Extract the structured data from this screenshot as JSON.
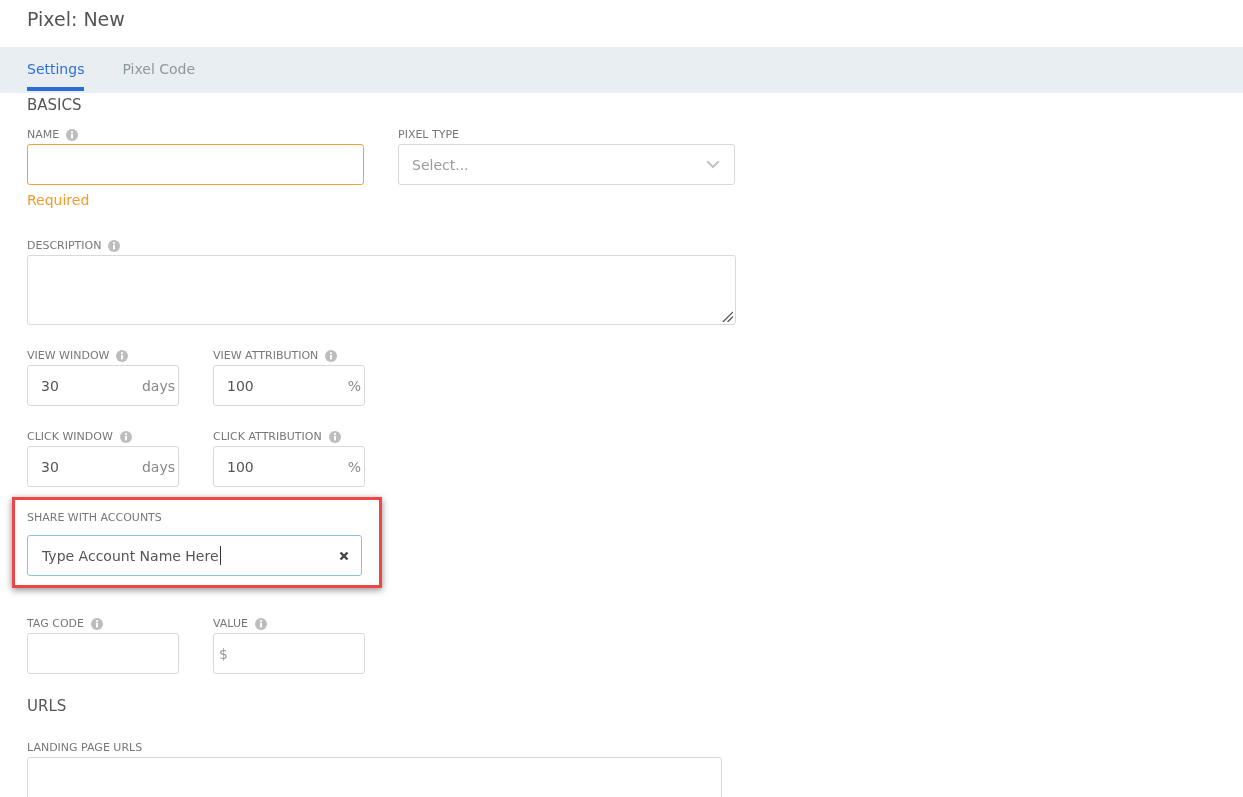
{
  "title": "Pixel: New",
  "tabs": [
    {
      "label": "Settings",
      "selected": true
    },
    {
      "label": "Pixel Code",
      "selected": false
    }
  ],
  "sections": [
    {
      "heading": "BASICS",
      "rows": [
        {
          "highlighted": false,
          "fields": [
            {
              "kind": "text",
              "label": "NAME",
              "info": true,
              "focused": false,
              "error": "Required"
            },
            {
              "kind": "select",
              "label": "PIXEL TYPE",
              "info": false,
              "focused": false,
              "placeholder": "Select..."
            }
          ]
        },
        {
          "highlighted": false,
          "fields": [
            {
              "kind": "textarea",
              "label": "DESCRIPTION",
              "info": true,
              "focused": false,
              "resizable": true
            }
          ]
        },
        {
          "highlighted": false,
          "fields": [
            {
              "kind": "short",
              "label": "VIEW WINDOW",
              "info": true,
              "focused": false,
              "value": "30",
              "suffix": "days"
            },
            {
              "kind": "short",
              "label": "VIEW ATTRIBUTION",
              "info": true,
              "focused": false,
              "value": "100",
              "suffix": "%"
            }
          ]
        },
        {
          "highlighted": false,
          "fields": [
            {
              "kind": "short",
              "label": "CLICK WINDOW",
              "info": true,
              "focused": false,
              "value": "30",
              "suffix": "days"
            },
            {
              "kind": "short",
              "label": "CLICK ATTRIBUTION",
              "info": true,
              "focused": false,
              "value": "100",
              "suffix": "%"
            }
          ]
        },
        {
          "highlighted": true,
          "fields": [
            {
              "kind": "search",
              "label": "SHARE WITH ACCOUNTS",
              "info": false,
              "focused": true,
              "value": "Type Account Name Here"
            }
          ]
        },
        {
          "highlighted": false,
          "fields": [
            {
              "kind": "short",
              "label": "TAG CODE",
              "info": true,
              "focused": false
            },
            {
              "kind": "short",
              "label": "VALUE",
              "info": true,
              "focused": false,
              "prefix": "$"
            }
          ]
        }
      ]
    },
    {
      "heading": "URLS",
      "rows": [
        {
          "highlighted": false,
          "fields": [
            {
              "kind": "textarea",
              "label": "LANDING PAGE URLS",
              "info": false,
              "focused": false
            }
          ]
        }
      ]
    }
  ]
}
